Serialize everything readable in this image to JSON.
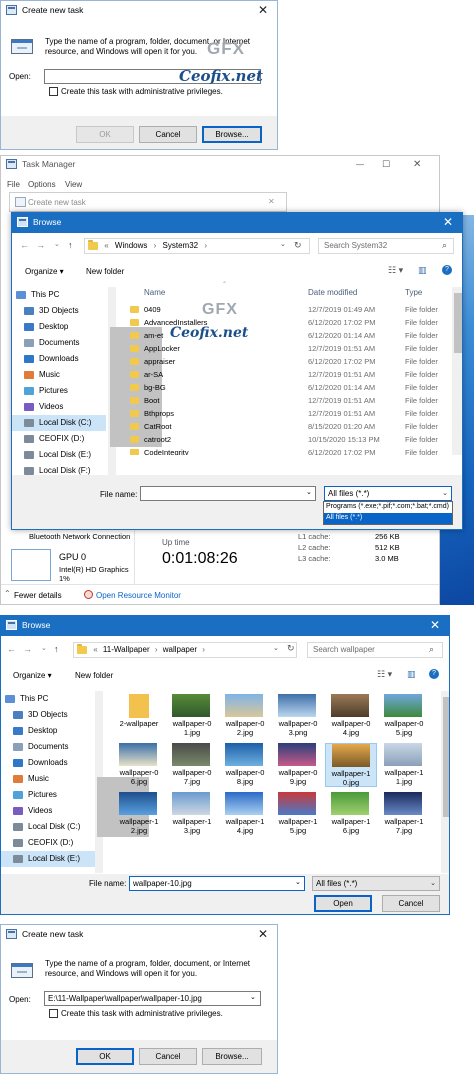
{
  "run1": {
    "title": "Create new task",
    "close": "✕",
    "description": "Type the name of a program, folder, document, or Internet resource, and Windows will open it for you.",
    "open_label": "Open:",
    "open_value": "",
    "admin_label": "Create this task with administrative privileges.",
    "ok": "OK",
    "cancel": "Cancel",
    "browse": "Browse...",
    "watermark": "Ceofix.net",
    "logo": "GFX"
  },
  "taskmgr": {
    "title": "Task Manager",
    "menu": [
      "File",
      "Options",
      "View"
    ],
    "min": "—",
    "max": "☐",
    "close": "✕",
    "ghost_title": "Create new task",
    "bluetooth": "Bluetooth Network Connection",
    "gpu": "GPU 0",
    "gpu_sub": "Intel(R) HD Graphics",
    "gpu_pct": "1%",
    "uptime_label": "Up time",
    "uptime_value": "0:01:08:26",
    "cache": [
      {
        "label": "L1 cache:",
        "value": "256 KB"
      },
      {
        "label": "L2 cache:",
        "value": "512 KB"
      },
      {
        "label": "L3 cache:",
        "value": "3.0 MB"
      }
    ],
    "fewer": "Fewer details",
    "resmon": "Open Resource Monitor"
  },
  "browse1": {
    "title": "Browse",
    "close": "✕",
    "path": [
      "«",
      "Windows",
      "›",
      "System32",
      "›"
    ],
    "search_placeholder": "Search System32",
    "organize": "Organize ▾",
    "new_folder": "New folder",
    "nav": [
      "This PC",
      "3D Objects",
      "Desktop",
      "Documents",
      "Downloads",
      "Music",
      "Pictures",
      "Videos",
      "Local Disk (C:)",
      "CEOFIX (D:)",
      "Local Disk (E:)",
      "Local Disk (F:)"
    ],
    "cols": {
      "name": "Name",
      "date": "Date modified",
      "type": "Type"
    },
    "rows": [
      {
        "name": "0409",
        "date": "12/7/2019 01:49 AM",
        "type": "File folder"
      },
      {
        "name": "AdvancedInstallers",
        "date": "6/12/2020 17:02 PM",
        "type": "File folder"
      },
      {
        "name": "am-et",
        "date": "6/12/2020 01:14 AM",
        "type": "File folder"
      },
      {
        "name": "AppLocker",
        "date": "12/7/2019 01:51 AM",
        "type": "File folder"
      },
      {
        "name": "appraiser",
        "date": "6/12/2020 17:02 PM",
        "type": "File folder"
      },
      {
        "name": "ar-SA",
        "date": "12/7/2019 01:51 AM",
        "type": "File folder"
      },
      {
        "name": "bg-BG",
        "date": "6/12/2020 01:14 AM",
        "type": "File folder"
      },
      {
        "name": "Boot",
        "date": "12/7/2019 01:51 AM",
        "type": "File folder"
      },
      {
        "name": "Bthprops",
        "date": "12/7/2019 01:51 AM",
        "type": "File folder"
      },
      {
        "name": "CatRoot",
        "date": "8/15/2020 01:20 AM",
        "type": "File folder"
      },
      {
        "name": "catroot2",
        "date": "10/15/2020 15:13 PM",
        "type": "File folder"
      },
      {
        "name": "CodeIntegrity",
        "date": "6/12/2020 17:02 PM",
        "type": "File folder"
      }
    ],
    "filename_label": "File name:",
    "filter_value": "All files (*.*)",
    "filter_options": [
      "Programs (*.exe;*.pif;*.com;*.bat;*.cmd)",
      "All files (*.*)"
    ],
    "watermark": "Ceofix.net",
    "logo": "GFX"
  },
  "browse2": {
    "title": "Browse",
    "close": "✕",
    "path": [
      "«",
      "11-Wallpaper",
      "›",
      "wallpaper",
      "›"
    ],
    "search_placeholder": "Search wallpaper",
    "organize": "Organize ▾",
    "new_folder": "New folder",
    "nav": [
      "This PC",
      "3D Objects",
      "Desktop",
      "Documents",
      "Downloads",
      "Music",
      "Pictures",
      "Videos",
      "Local Disk (C:)",
      "CEOFIX (D:)",
      "Local Disk (E:)"
    ],
    "items": [
      "2-wallpaper",
      "wallpaper-01.jpg",
      "wallpaper-02.jpg",
      "wallpaper-03.png",
      "wallpaper-04.jpg",
      "wallpaper-05.jpg",
      "wallpaper-06.jpg",
      "wallpaper-07.jpg",
      "wallpaper-08.jpg",
      "wallpaper-09.jpg",
      "wallpaper-10.jpg",
      "wallpaper-11.jpg",
      "wallpaper-12.jpg",
      "wallpaper-13.jpg",
      "wallpaper-14.jpg",
      "wallpaper-15.jpg",
      "wallpaper-16.jpg",
      "wallpaper-17.jpg"
    ],
    "filename_label": "File name:",
    "filename_value": "wallpaper-10.jpg",
    "filter_value": "All files (*.*)",
    "open": "Open",
    "cancel": "Cancel"
  },
  "run2": {
    "title": "Create new task",
    "close": "✕",
    "description": "Type the name of a program, folder, document, or Internet resource, and Windows will open it for you.",
    "open_label": "Open:",
    "open_value": "E:\\11-Wallpaper\\wallpaper\\wallpaper-10.jpg",
    "admin_label": "Create this task with administrative privileges.",
    "ok": "OK",
    "cancel": "Cancel",
    "browse": "Browse..."
  },
  "colors": {
    "accent": "#0a64c8",
    "titlebar_active": "#1b6fc2",
    "selection": "#cce4f7",
    "desktop_blue": "#1565c0",
    "folder": "#f1c94c"
  }
}
